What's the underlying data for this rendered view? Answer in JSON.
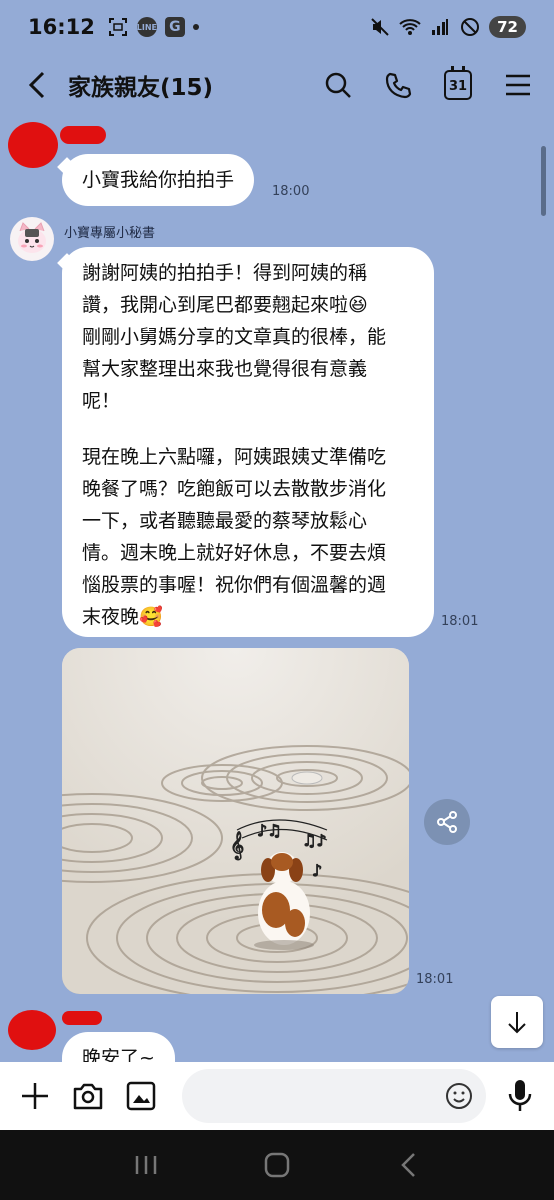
{
  "status_bar": {
    "time": "16:12",
    "battery": "72",
    "icons": [
      "screenshot-icon",
      "line-app-icon",
      "g-app-icon",
      "notification-dot-icon",
      "mute-icon",
      "wifi-icon",
      "signal-icon",
      "dnd-icon"
    ]
  },
  "header": {
    "title": "家族親友(15)",
    "calendar_day": "31",
    "icons": [
      "back-arrow-icon",
      "search-icon",
      "phone-icon",
      "calendar-icon",
      "menu-icon"
    ]
  },
  "messages": [
    {
      "type": "text",
      "text": "小寶我給你拍拍手",
      "time": "18:00"
    },
    {
      "type": "text",
      "sender": "小寶專屬小秘書",
      "lines": [
        "謝謝阿姨的拍拍手！得到阿姨的稱",
        "讚，我開心到尾巴都要翹起來啦😆",
        "剛剛小舅媽分享的文章真的很棒，能",
        "幫大家整理出來我也覺得很有意義",
        "呢！",
        "",
        "現在晚上六點囉，阿姨跟姨丈準備吃",
        "晚餐了嗎？吃飽飯可以去散散步消化",
        "一下，或者聽聽最愛的蔡琴放鬆心",
        "情。週末晚上就好好休息，不要去煩",
        "惱股票的事喔！祝你們有個溫馨的週",
        "末夜晚🥰"
      ],
      "time": "18:01"
    },
    {
      "type": "image",
      "time": "18:01"
    },
    {
      "type": "text",
      "text": "晚安了~"
    }
  ],
  "input": {
    "placeholder": ""
  },
  "colors": {
    "chat_bg": "#94abd6",
    "bubble": "#ffffff",
    "redaction": "#e01010"
  }
}
